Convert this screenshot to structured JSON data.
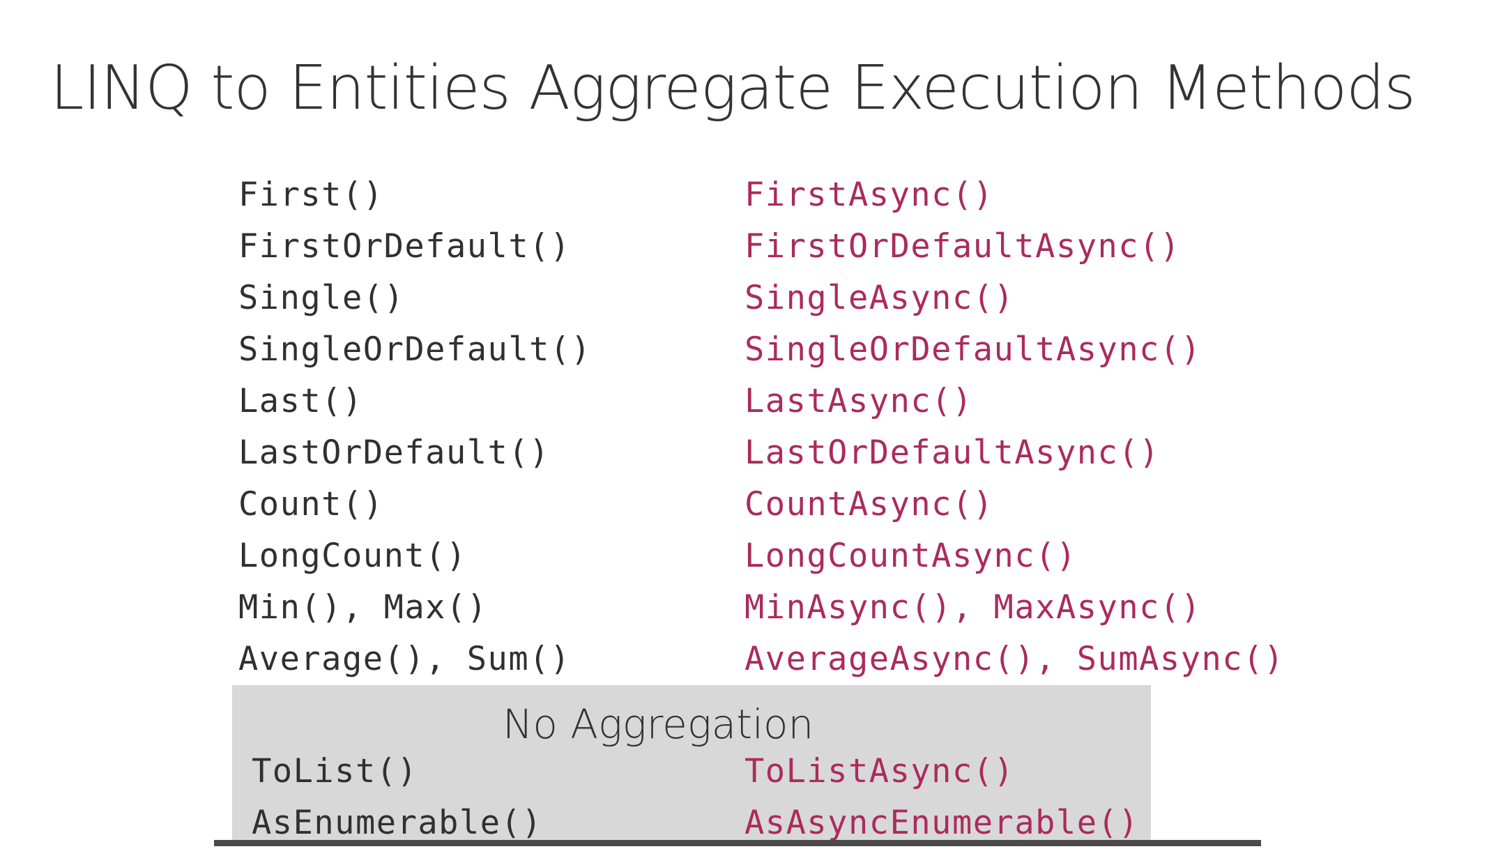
{
  "title": "LINQ to Entities Aggregate Execution Methods",
  "aggregate_methods": [
    {
      "sync": "First()",
      "async": "FirstAsync()"
    },
    {
      "sync": "FirstOrDefault()",
      "async": "FirstOrDefaultAsync()"
    },
    {
      "sync": "Single()",
      "async": "SingleAsync()"
    },
    {
      "sync": "SingleOrDefault()",
      "async": "SingleOrDefaultAsync()"
    },
    {
      "sync": "Last()",
      "async": "LastAsync()"
    },
    {
      "sync": "LastOrDefault()",
      "async": "LastOrDefaultAsync()"
    },
    {
      "sync": "Count()",
      "async": "CountAsync()"
    },
    {
      "sync": "LongCount()",
      "async": "LongCountAsync()"
    },
    {
      "sync": "Min(), Max()",
      "async": "MinAsync(), MaxAsync()"
    },
    {
      "sync": "Average(), Sum()",
      "async": "AverageAsync(), SumAsync()"
    }
  ],
  "no_aggregation": {
    "heading": "No Aggregation",
    "methods": [
      {
        "sync": "ToList()",
        "async": "ToListAsync()"
      },
      {
        "sync": "AsEnumerable()",
        "async": "AsAsyncEnumerable()"
      }
    ]
  },
  "colors": {
    "title": "#333333",
    "sync_text": "#303030",
    "async_text": "#ab2b5c",
    "panel_background": "#d8d8d8",
    "bottom_bar": "#4a4a4a"
  }
}
